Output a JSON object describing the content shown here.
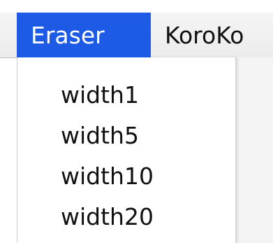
{
  "menubar": {
    "menus": [
      {
        "label": "Eraser",
        "active": true
      },
      {
        "label": "KoroKo",
        "active": false
      }
    ]
  },
  "eraser_menu": {
    "items": [
      {
        "label": "width1"
      },
      {
        "label": "width5"
      },
      {
        "label": "width10"
      },
      {
        "label": "width20"
      }
    ]
  },
  "colors": {
    "active_menu_bg": "#1d5be6",
    "active_menu_text": "#ffffff",
    "menu_text": "#111111"
  }
}
